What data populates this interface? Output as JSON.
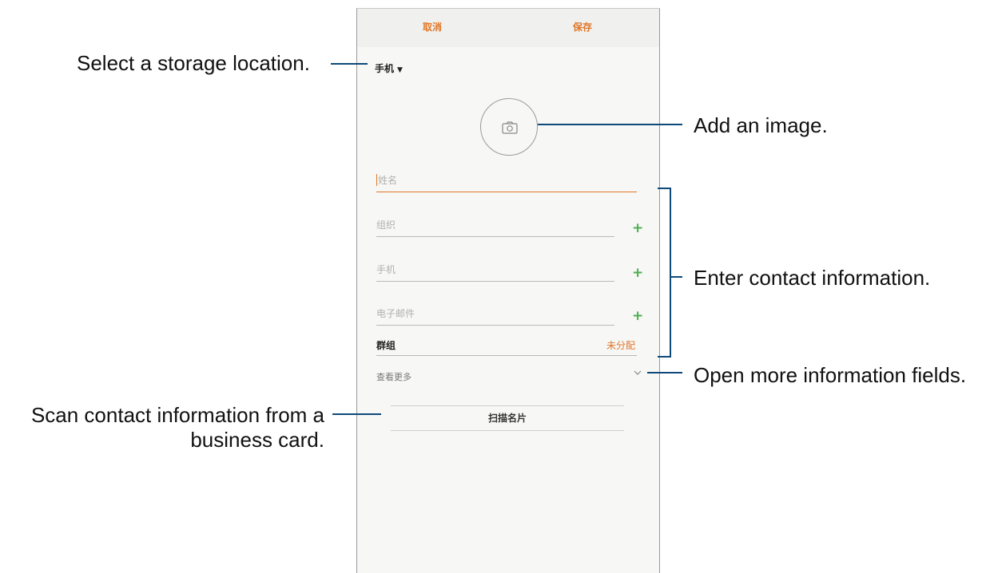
{
  "topbar": {
    "cancel_label": "取消",
    "save_label": "保存"
  },
  "storage": {
    "label": "手机",
    "caret": "▼"
  },
  "fields": {
    "name_placeholder": "姓名",
    "organization_placeholder": "组织",
    "mobile_placeholder": "手机",
    "email_placeholder": "电子邮件",
    "plus": "+"
  },
  "group": {
    "label": "群组",
    "value": "未分配"
  },
  "more": {
    "label": "查看更多"
  },
  "scan": {
    "label": "扫描名片"
  },
  "callouts": {
    "storage": "Select a storage location.",
    "image": "Add an image.",
    "contact": "Enter contact information.",
    "more": "Open more information fields.",
    "scan_line1": "Scan contact information from a",
    "scan_line2": "business card."
  },
  "colors": {
    "accent": "#e0772a",
    "plus": "#4caf50",
    "callout_line": "#0d4a7a"
  }
}
